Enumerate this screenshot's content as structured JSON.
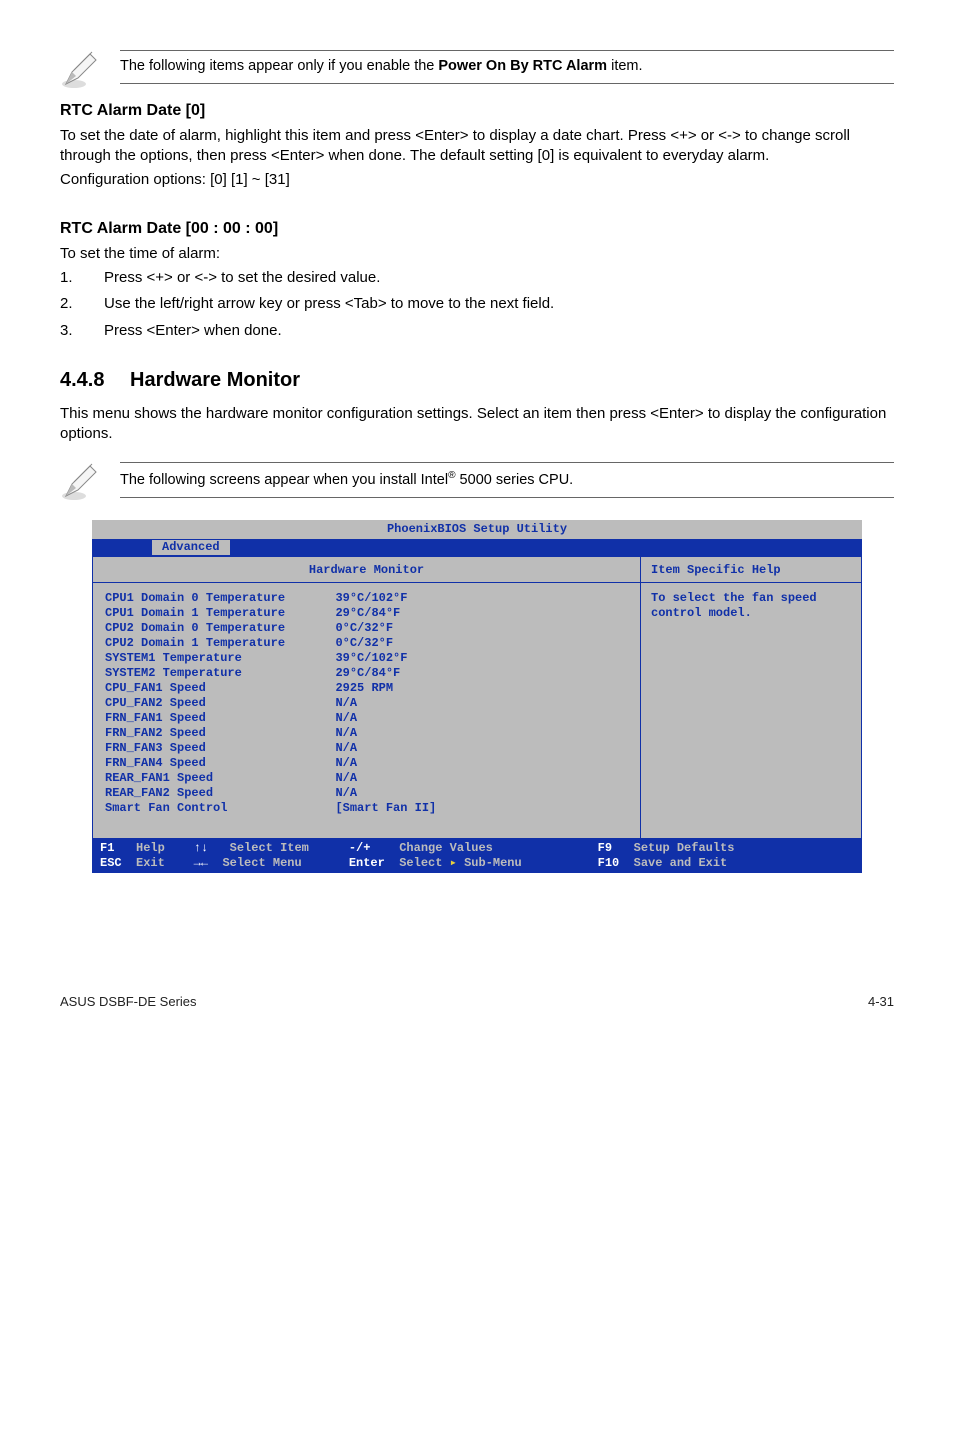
{
  "note1": {
    "pre": "The following items appear only if you enable the ",
    "bold": "Power On By RTC Alarm",
    "post": " item."
  },
  "rtc_date": {
    "heading": "RTC Alarm Date [0]",
    "p1": "To set the date of alarm, highlight this item and press <Enter> to display a date chart. Press <+> or <-> to change scroll through the options, then press <Enter> when done. The default setting [0] is equivalent to everyday alarm.",
    "p2": "Configuration options: [0] [1] ~ [31]"
  },
  "rtc_time": {
    "heading": "RTC Alarm Date [00 : 00 : 00]",
    "p1": "To set the time of alarm:",
    "steps": [
      {
        "n": "1.",
        "t": "Press <+> or <-> to set the desired value."
      },
      {
        "n": "2.",
        "t": "Use the left/right arrow key or press <Tab> to move to the next field."
      },
      {
        "n": "3.",
        "t": "Press <Enter> when done."
      }
    ]
  },
  "sec": {
    "num": "4.4.8",
    "title": "Hardware Monitor",
    "p": "This menu shows the hardware monitor configuration settings.  Select an item then press <Enter> to display the configuration options."
  },
  "note2": {
    "pre": "The following screens appear when you install Intel",
    "sup": "®",
    "post": " 5000 series CPU."
  },
  "bios": {
    "title": "PhoenixBIOS Setup Utility",
    "tab": "Advanced",
    "panel_title": "Hardware Monitor",
    "help_title": "Item Specific Help",
    "help_text": "To select the fan speed control model.",
    "rows": [
      {
        "l": "CPU1 Domain 0 Temperature",
        "v": "39°C/102°F"
      },
      {
        "l": "CPU1 Domain 1 Temperature",
        "v": "29°C/84°F"
      },
      {
        "l": "CPU2 Domain 0 Temperature",
        "v": "0°C/32°F"
      },
      {
        "l": "CPU2 Domain 1 Temperature",
        "v": "0°C/32°F"
      },
      {
        "l": "SYSTEM1 Temperature",
        "v": "39°C/102°F"
      },
      {
        "l": "SYSTEM2 Temperature",
        "v": "29°C/84°F"
      },
      {
        "l": "CPU_FAN1 Speed",
        "v": "2925 RPM"
      },
      {
        "l": "CPU_FAN2 Speed",
        "v": "N/A"
      },
      {
        "l": "FRN_FAN1 Speed",
        "v": "N/A"
      },
      {
        "l": "FRN_FAN2 Speed",
        "v": "N/A"
      },
      {
        "l": "FRN_FAN3 Speed",
        "v": "N/A"
      },
      {
        "l": "FRN_FAN4 Speed",
        "v": "N/A"
      },
      {
        "l": "REAR_FAN1 Speed",
        "v": "N/A"
      },
      {
        "l": "REAR_FAN2 Speed",
        "v": "N/A"
      },
      {
        "l": "Smart Fan Control",
        "v": "[Smart Fan II]"
      }
    ],
    "footer": {
      "a1k": "F1",
      "a1t": "Help",
      "a2k": "ESC",
      "a2t": "Exit",
      "b1k": "↑↓",
      "b1t": "Select Item",
      "b2k": "→←",
      "b2t": "Select Menu",
      "c1k": "-/+",
      "c1t": "Change Values",
      "c2k": "Enter",
      "c2t_a": "Select ",
      "c2t_b": "▸",
      "c2t_c": " Sub-Menu",
      "d1k": "F9",
      "d1t": "Setup Defaults",
      "d2k": "F10",
      "d2t": "Save and Exit"
    }
  },
  "footer": {
    "left": "ASUS DSBF-DE Series",
    "right": "4-31"
  }
}
